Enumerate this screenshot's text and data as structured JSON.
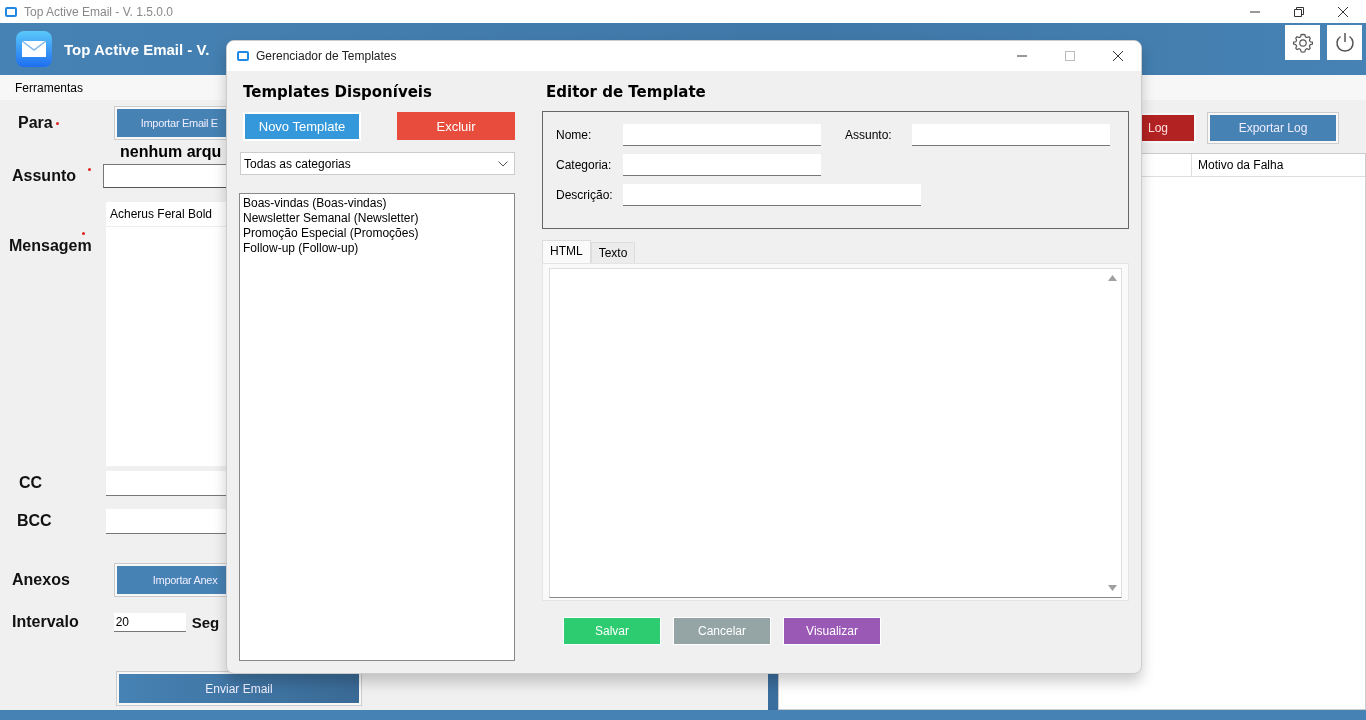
{
  "app_window": {
    "title": "Top Active Email - V. 1.5.0.0"
  },
  "header": {
    "title": "Top Active Email - V."
  },
  "menu": [
    "Ferramentas"
  ],
  "form": {
    "to_label": "Para",
    "to_required": true,
    "import_emails_button": "Importar Email E",
    "file_status": "nenhum arqu",
    "subject_label": "Assunto",
    "subject_required": true,
    "font_name": "Acherus Feral Bold",
    "message_label": "Mensagem",
    "message_required": true,
    "cc_label": "CC",
    "bcc_label": "BCC",
    "attachments_label": "Anexos",
    "import_attachments_button": "Importar Anex",
    "interval_label": "Intervalo",
    "interval_value": "20",
    "seconds_label": "Seg",
    "send_button": "Enviar Email"
  },
  "log": {
    "clear_button": "Log",
    "export_button": "Exportar Log",
    "columns": [
      "Motivo da Falha"
    ]
  },
  "dialog": {
    "title": "Gerenciador de Templates",
    "list_heading": "Templates Disponíveis",
    "new_button": "Novo Template",
    "delete_button": "Excluir",
    "category_filter": "Todas as categorias",
    "templates": [
      "Boas-vindas (Boas-vindas)",
      "Newsletter Semanal (Newsletter)",
      "Promoção Especial (Promoções)",
      "Follow-up (Follow-up)"
    ],
    "editor_heading": "Editor de Template",
    "field_rows": [
      [
        {
          "label": "Nome:",
          "wide": false
        },
        {
          "label": "Assunto:",
          "wide": false
        }
      ],
      [
        {
          "label": "Categoria:",
          "wide": false
        }
      ],
      [
        {
          "label": "Descrição:",
          "wide": true
        }
      ]
    ],
    "tabs": [
      {
        "label": "HTML",
        "selected": true
      },
      {
        "label": "Texto",
        "selected": false
      }
    ],
    "buttons": [
      {
        "label": "Salvar",
        "kind": "save"
      },
      {
        "label": "Cancelar",
        "kind": "cancel"
      },
      {
        "label": "Visualizar",
        "kind": "preview"
      }
    ]
  }
}
